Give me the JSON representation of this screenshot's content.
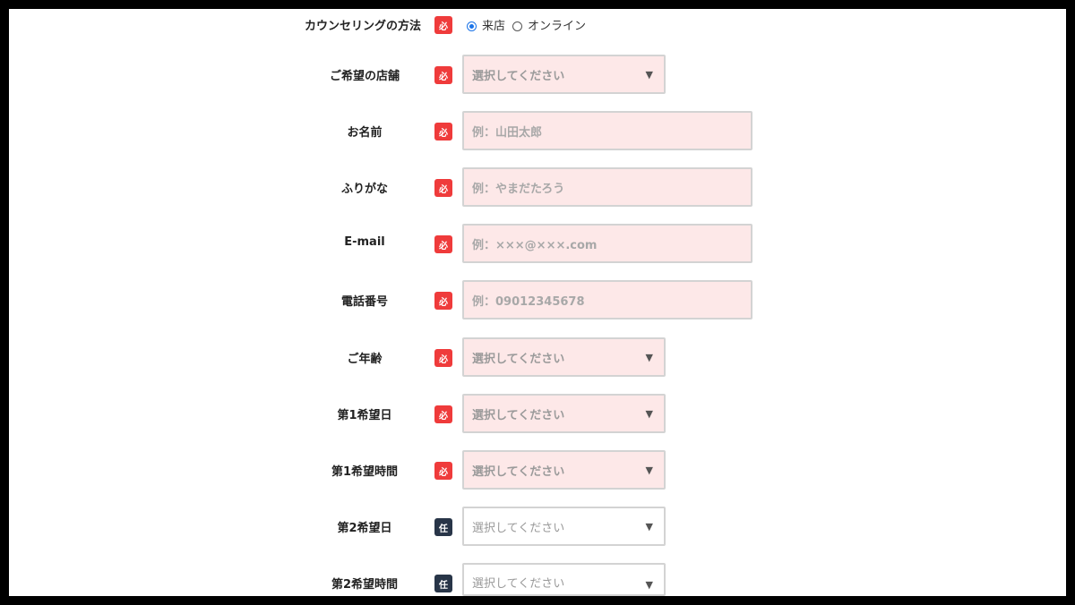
{
  "badges": {
    "required": "必",
    "optional": "任"
  },
  "method": {
    "label": "カウンセリングの方法",
    "options": [
      {
        "label": "来店",
        "checked": true
      },
      {
        "label": "オンライン",
        "checked": false
      }
    ]
  },
  "fields": {
    "store": {
      "label": "ご希望の店舗",
      "placeholder": "選択してください"
    },
    "name": {
      "label": "お名前",
      "placeholder": "例：山田太郎"
    },
    "kana": {
      "label": "ふりがな",
      "placeholder": "例：やまだたろう"
    },
    "email": {
      "label": "E-mail",
      "placeholder": "例：×××@×××.com"
    },
    "phone": {
      "label": "電話番号",
      "placeholder": "例：09012345678"
    },
    "age": {
      "label": "ご年齢",
      "placeholder": "選択してください"
    },
    "date1": {
      "label": "第1希望日",
      "placeholder": "選択してください"
    },
    "time1": {
      "label": "第1希望時間",
      "placeholder": "選択してください"
    },
    "date2": {
      "label": "第2希望日",
      "placeholder": "選択してください"
    },
    "time2": {
      "label": "第2希望時間",
      "placeholder": "選択してください"
    }
  },
  "colors": {
    "required_badge": "#ef3b3b",
    "optional_badge": "#283548",
    "required_field_bg": "#fde8e8",
    "radio_checked": "#1a73e8"
  }
}
